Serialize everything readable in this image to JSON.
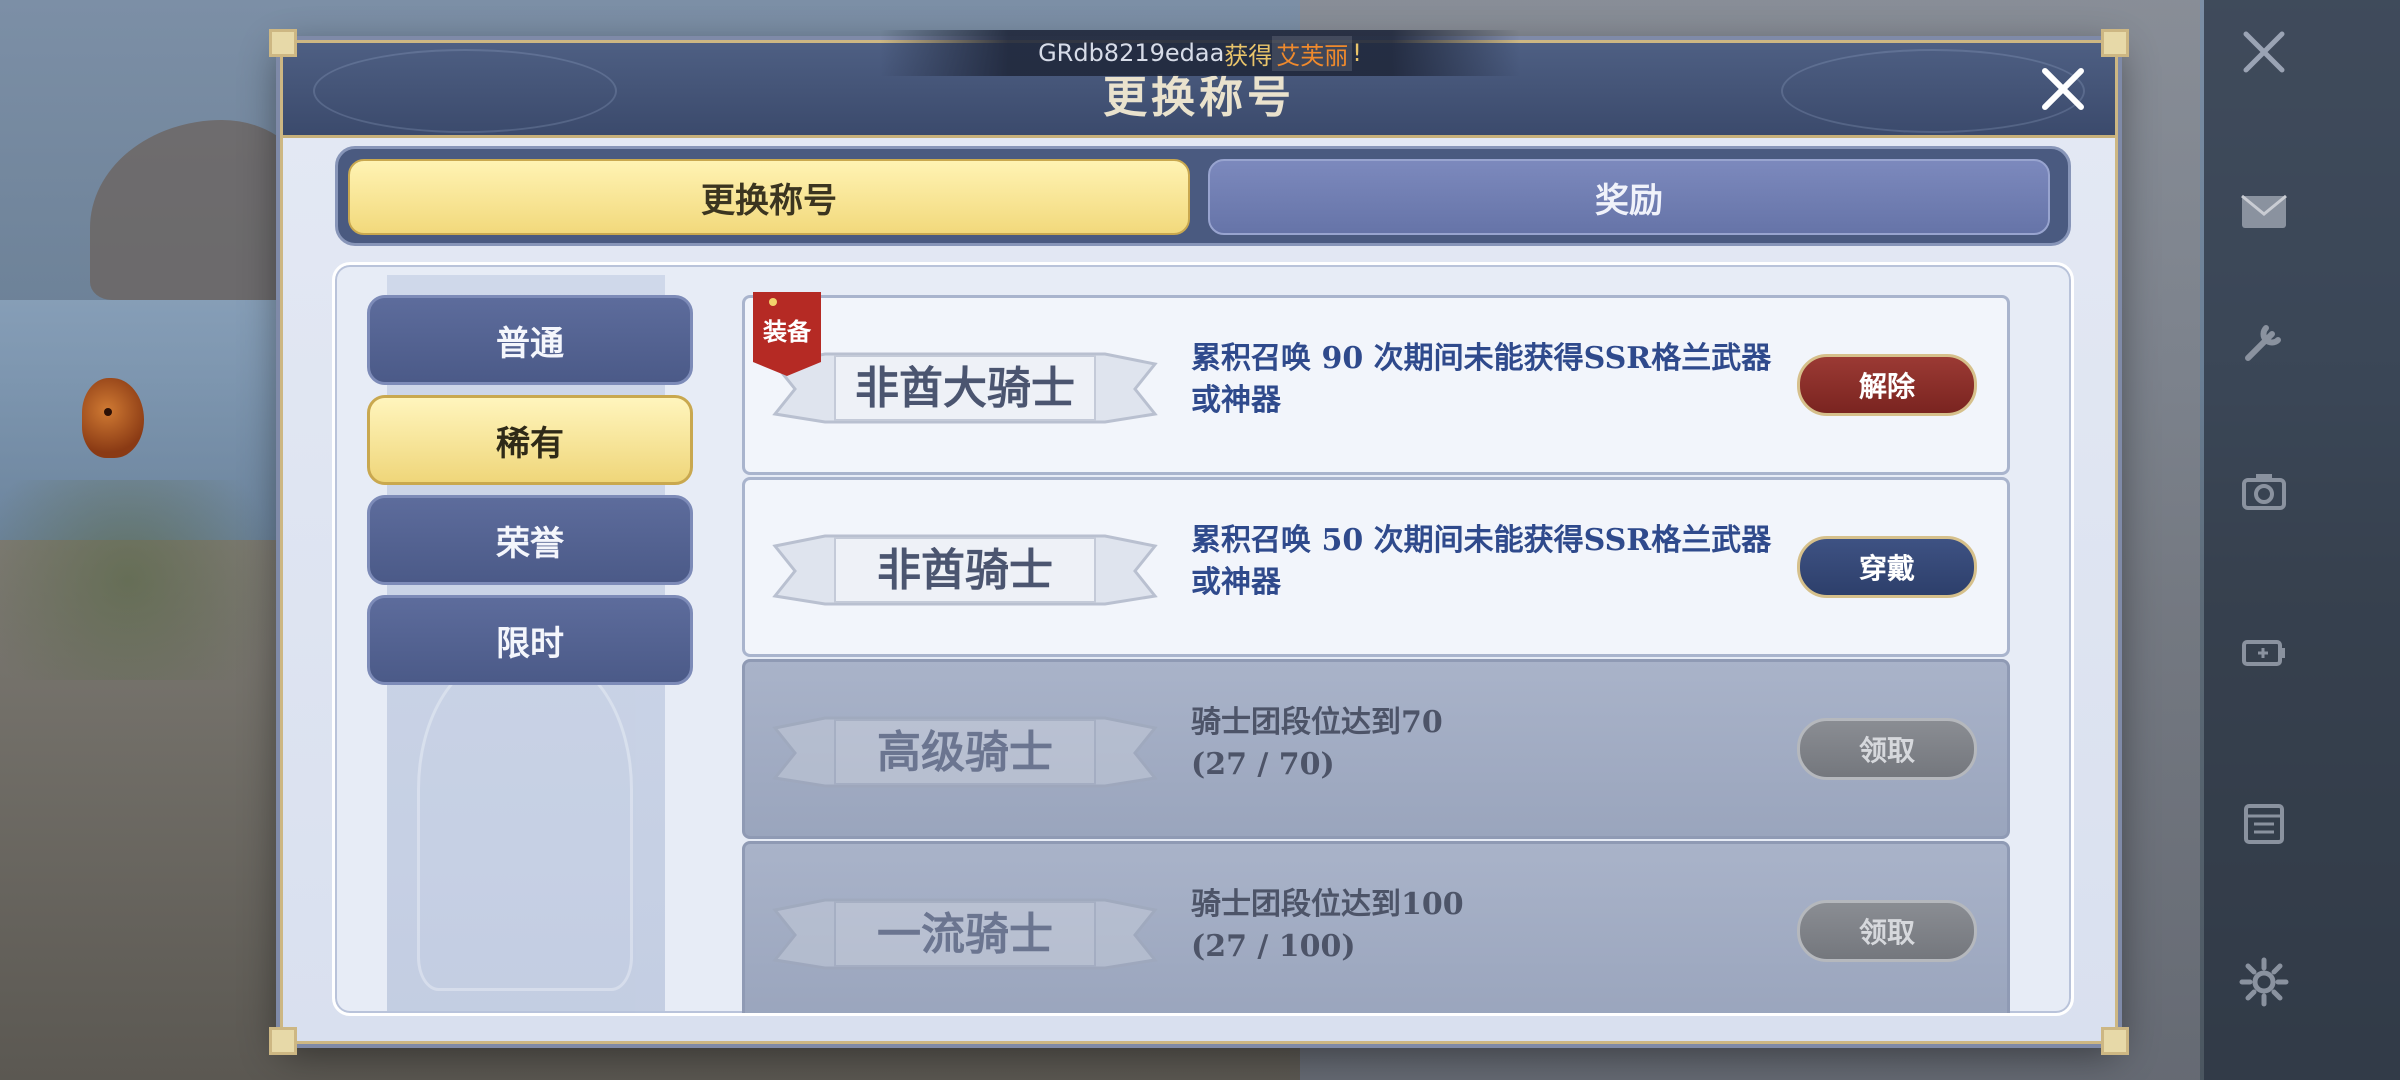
{
  "notification": {
    "user": "GRdb8219edaa",
    "verb": "获得",
    "item": "艾芙丽",
    "suffix": "!"
  },
  "dialog": {
    "title": "更换称号",
    "close_icon": "close-icon"
  },
  "tabs": [
    {
      "label": "更换称号",
      "active": true
    },
    {
      "label": "奖励",
      "active": false
    }
  ],
  "categories": [
    {
      "label": "普通",
      "active": false
    },
    {
      "label": "稀有",
      "active": true
    },
    {
      "label": "荣誉",
      "active": false
    },
    {
      "label": "限时",
      "active": false
    }
  ],
  "titles": [
    {
      "name": "非酋大骑士",
      "desc_line1": "累积召唤 90 次期间未能获得SSR格兰武器",
      "desc_line2": "或神器",
      "action": "解除",
      "equipped_tag": "装备",
      "state": "equipped"
    },
    {
      "name": "非酋骑士",
      "desc_line1": "累积召唤 50 次期间未能获得SSR格兰武器",
      "desc_line2": "或神器",
      "action": "穿戴",
      "state": "available"
    },
    {
      "name": "高级骑士",
      "desc_line1": "骑士团段位达到70",
      "desc_line2": "(27 / 70)",
      "action": "领取",
      "state": "locked"
    },
    {
      "name": "一流骑士",
      "desc_line1": "骑士团段位达到100",
      "desc_line2": "(27 / 100)",
      "action": "领取",
      "state": "locked"
    }
  ],
  "sidebar_icons": [
    "close-icon",
    "postcard-icon",
    "tools-icon",
    "camera-icon",
    "battery-icon",
    "calendar-icon",
    "gear-icon"
  ],
  "colors": {
    "accent_gold": "#f2d97c",
    "navy": "#4b5a88",
    "remove_red": "#7a2420",
    "wear_blue": "#2d3f6b"
  }
}
